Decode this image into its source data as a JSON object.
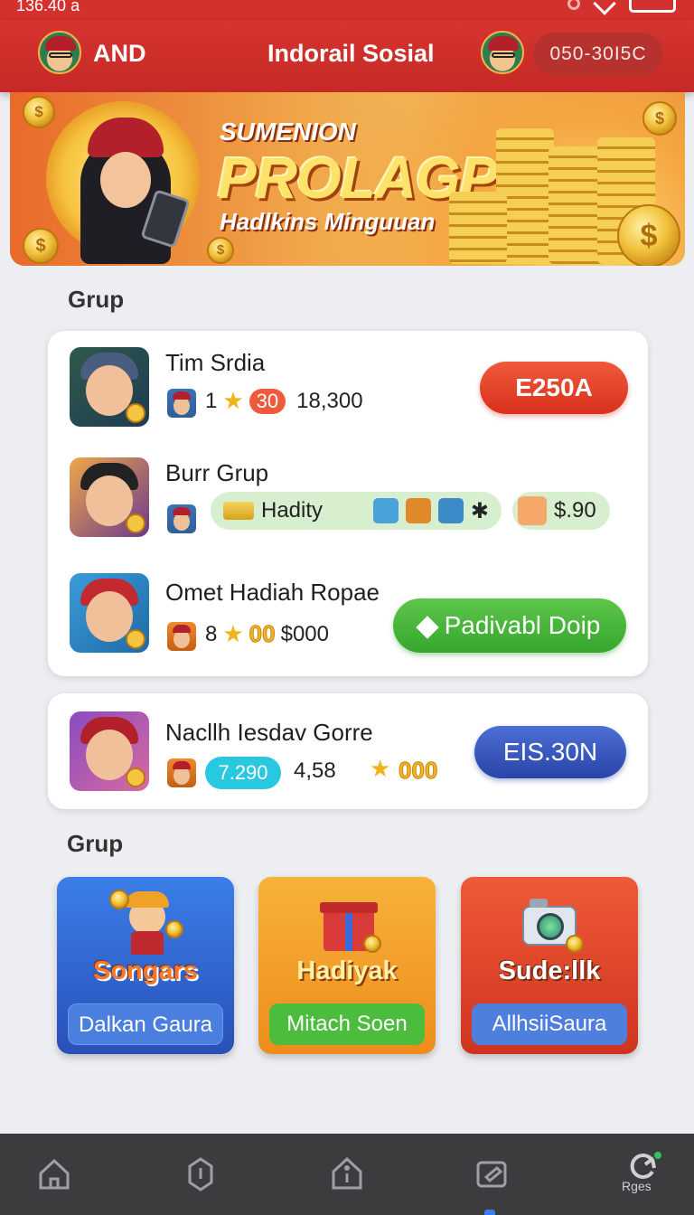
{
  "status_bar": {
    "time": "136.40",
    "extra": "a"
  },
  "header": {
    "brand": "AND",
    "title": "Indorail Sosial",
    "id_pill": "050-30I5C"
  },
  "banner": {
    "line1": "SUMENION",
    "line2": "PROLAGP!!",
    "line3": "Hadlkins Minguuan"
  },
  "sections": {
    "first": "Grup",
    "second": "Grup"
  },
  "groups": [
    {
      "title": "Tim Srdia",
      "count": "1",
      "badge": "30",
      "score": "18,300",
      "action": "E250A"
    },
    {
      "title": "Burr Grup",
      "chip_label": "Hadity",
      "price": "$.90"
    },
    {
      "title": "Omet  Hadiah Ropae",
      "count": "8",
      "gold": "00",
      "value": "$000",
      "action": "Padivabl Doip"
    }
  ],
  "featured": {
    "title": "Nacllh Iesdav Gorre",
    "badge": "7.290",
    "value": "4,58",
    "gold": "000",
    "action": "EIS.30N"
  },
  "tiles": [
    {
      "name": "Songars",
      "button": "Dalkan Gaura",
      "color": "#2f67d8"
    },
    {
      "name": "Hadiyak",
      "button": "Mitach Soen",
      "color": "#f2a224"
    },
    {
      "name": "Sude:llk",
      "button": "AllhsiiSaura",
      "color": "#e04b2a"
    }
  ],
  "nav": {
    "last_label": "Rges",
    "icons": [
      "home-icon",
      "tag-icon",
      "info-icon",
      "edit-icon",
      "refresh-icon"
    ]
  },
  "colors": {
    "header": "#d3312e",
    "accent_red": "#e8452b",
    "accent_green": "#46b53a",
    "accent_blue": "#3552c0"
  }
}
